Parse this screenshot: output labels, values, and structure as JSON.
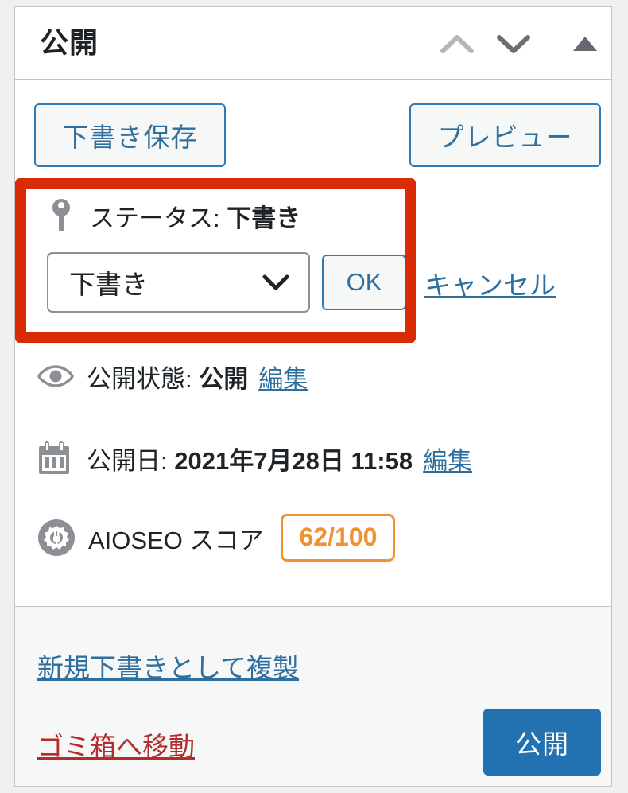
{
  "panel": {
    "title": "公開",
    "header_icons": {
      "order_up": "chevron-up-icon",
      "order_down": "chevron-down-icon",
      "toggle": "triangle-up-icon"
    }
  },
  "actions": {
    "save_draft": "下書き保存",
    "preview": "プレビュー"
  },
  "status": {
    "icon": "pin-icon",
    "label_prefix": "ステータス: ",
    "label_value": "下書き",
    "select_value": "下書き",
    "select_chevron": "chevron-down-icon",
    "ok_label": "OK",
    "cancel_label": "キャンセル"
  },
  "visibility": {
    "icon": "eye-icon",
    "label_prefix": "公開状態: ",
    "label_value": "公開",
    "edit_label": "編集"
  },
  "publish_date": {
    "icon": "calendar-icon",
    "label_prefix": "公開日: ",
    "label_value": "2021年7月28日 11:58",
    "edit_label": "編集"
  },
  "aioseo": {
    "icon": "aioseo-gear-icon",
    "label": "AIOSEO スコア",
    "score": "62/100"
  },
  "footer": {
    "duplicate_label": "新規下書きとして複製",
    "trash_label": "ゴミ箱へ移動",
    "publish_label": "公開"
  },
  "colors": {
    "accent_blue": "#2271b1",
    "link_blue": "#2f6f9e",
    "trash_red": "#b32d2e",
    "annotation_red": "#d92b05",
    "score_orange": "#ef9234",
    "panel_border": "#c3c4c7",
    "footer_bg": "#f6f7f7"
  }
}
